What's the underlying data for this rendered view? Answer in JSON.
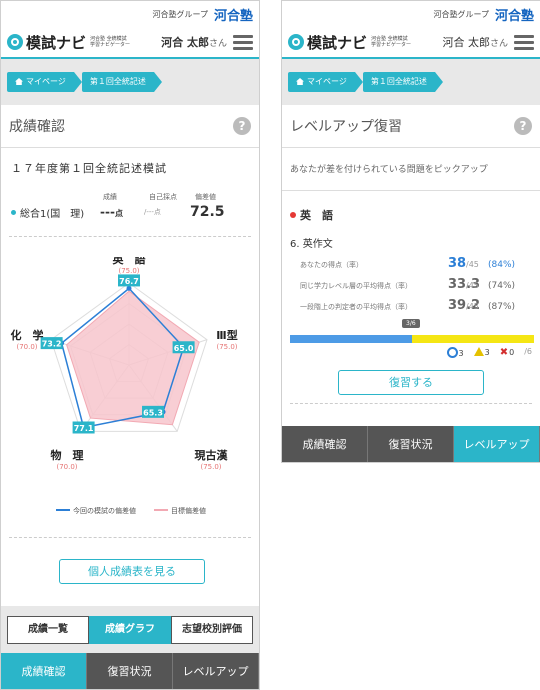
{
  "left": {
    "group": "河合塾グループ",
    "brand": "河合塾",
    "app_name": "模試ナビ",
    "app_sub": "河合塾 全統模試 学習ナビゲーター",
    "user": "河合 太郎",
    "user_suffix": "さん",
    "breadcrumb": [
      "マイページ",
      "第１回全統記述"
    ],
    "section_title": "成績確認",
    "exam_title": "１７年度第１回全統記述模試",
    "score_headers": [
      "成績",
      "自己採点",
      "偏差値"
    ],
    "subject": "総合1(国　理)",
    "score": "---",
    "score_unit": "点",
    "self_score": "/---点",
    "deviation": "72.5",
    "legend": [
      "今回の模試の偏差値",
      "目標偏差値"
    ],
    "personal_button": "個人成績表を見る",
    "subtabs": [
      "成績一覧",
      "成績グラフ",
      "志望校別評価"
    ],
    "nav": [
      "成績確認",
      "復習状況",
      "レベルアップ"
    ]
  },
  "chart_data": {
    "type": "radar",
    "axes": [
      "英　語",
      "Ⅲ型",
      "現古漢",
      "物　理",
      "化　学"
    ],
    "targets": [
      "(75.0)",
      "(75.0)",
      "(75.0)",
      "(70.0)",
      "(70.0)"
    ],
    "series": [
      {
        "name": "今回の模試の偏差値",
        "values": [
          76.7,
          65.0,
          65.3,
          77.1,
          73.2
        ],
        "color": "#2c7fd6"
      },
      {
        "name": "目標偏差値",
        "values": [
          75.0,
          75.0,
          75.0,
          70.0,
          70.0
        ],
        "color": "#f2a9b3"
      }
    ],
    "range": [
      30,
      80
    ]
  },
  "right": {
    "group": "河合塾グループ",
    "brand": "河合塾",
    "app_name": "模試ナビ",
    "app_sub": "河合塾 全統模試 学習ナビゲーター",
    "user": "河合 太郎",
    "user_suffix": "さん",
    "breadcrumb": [
      "マイページ",
      "第１回全統記述"
    ],
    "section_title": "レベルアップ復習",
    "description": "あなたが差を付けられている問題をピックアップ",
    "subject": "英　語",
    "question": "6. 英作文",
    "rows": [
      {
        "label": "あなたの得点（率）",
        "num": "38",
        "den": "/45",
        "pct": "(84%)",
        "color": "#2c7fd6"
      },
      {
        "label": "同じ学力レベル層の平均得点（率）",
        "num": "33.3",
        "den": "/45",
        "pct": "(74%)",
        "color": "#666"
      },
      {
        "label": "一段階上の判定者の平均得点（率）",
        "num": "39.2",
        "den": "/45",
        "pct": "(87%)",
        "color": "#666"
      }
    ],
    "progress_label": "3/6",
    "progress": 0.5,
    "marks": {
      "o": "3",
      "t": "3",
      "x": "0",
      "total": "/6"
    },
    "review_button": "復習する",
    "nav": [
      "成績確認",
      "復習状況",
      "レベルアップ"
    ]
  }
}
